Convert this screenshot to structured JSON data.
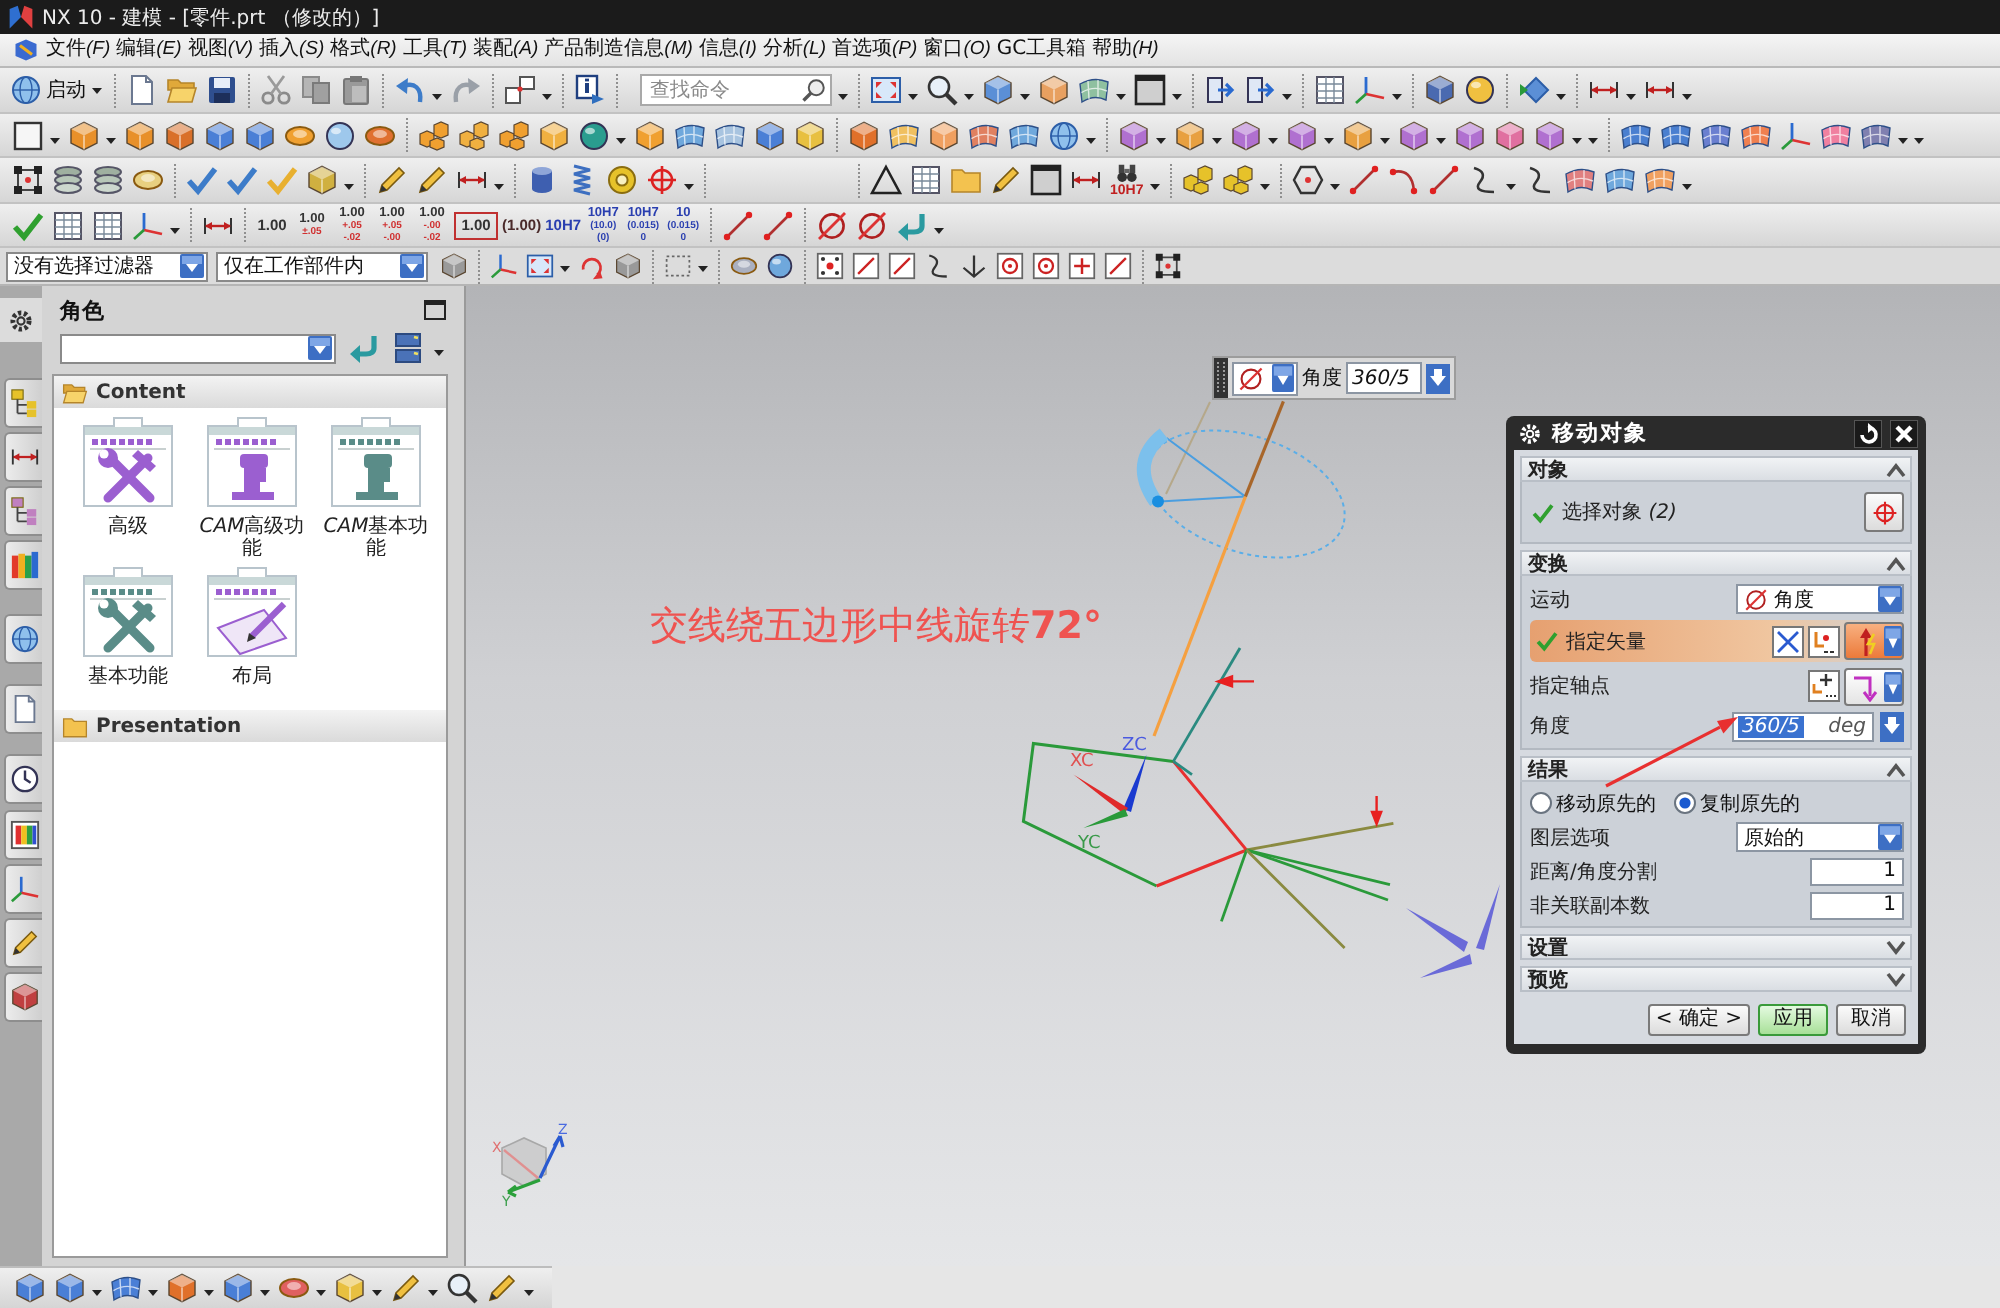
{
  "window": {
    "title": "NX 10 - 建模 - [零件.prt （修改的）]"
  },
  "menu": [
    {
      "label": "文件",
      "key": "(F)"
    },
    {
      "label": "编辑",
      "key": "(E)"
    },
    {
      "label": "视图",
      "key": "(V)"
    },
    {
      "label": "插入",
      "key": "(S)"
    },
    {
      "label": "格式",
      "key": "(R)"
    },
    {
      "label": "工具",
      "key": "(T)"
    },
    {
      "label": "装配",
      "key": "(A)"
    },
    {
      "label": "产品制造信息",
      "key": "(M)"
    },
    {
      "label": "信息",
      "key": "(I)"
    },
    {
      "label": "分析",
      "key": "(L)"
    },
    {
      "label": "首选项",
      "key": "(P)"
    },
    {
      "label": "窗口",
      "key": "(O)"
    },
    {
      "label": "GC工具箱"
    },
    {
      "label": "帮助",
      "key": "(H)"
    }
  ],
  "toolbar": {
    "start_label": "启动",
    "search_placeholder": "查找命令",
    "fit_check_label": "10H7",
    "dimension_styles": [
      {
        "kind": "plain",
        "lines": [
          "1.00"
        ]
      },
      {
        "kind": "tolerance",
        "lines": [
          "1.00",
          "±.05"
        ]
      },
      {
        "kind": "tolerance",
        "lines": [
          "1.00",
          "+.05",
          "-.02"
        ]
      },
      {
        "kind": "tolerance",
        "lines": [
          "1.00",
          "+.05",
          "-.00"
        ]
      },
      {
        "kind": "tolerance",
        "lines": [
          "1.00",
          "-.00",
          "-.02"
        ]
      },
      {
        "kind": "basic",
        "lines": [
          "1.00"
        ]
      },
      {
        "kind": "reference",
        "lines": [
          "(1.00)"
        ]
      },
      {
        "kind": "fit",
        "lines": [
          "10H7"
        ]
      },
      {
        "kind": "fit",
        "lines": [
          "10H7",
          "(10.0)",
          "(0)"
        ]
      },
      {
        "kind": "fit",
        "lines": [
          "10H7",
          "(0.015)",
          "0"
        ]
      },
      {
        "kind": "fit",
        "lines": [
          "10",
          "(0.015)",
          "0"
        ]
      }
    ]
  },
  "selection_bar": {
    "type_filter": "没有选择过滤器",
    "scope_filter": "仅在工作部件内"
  },
  "role_panel": {
    "title": "角色",
    "sections": [
      {
        "title": "Content",
        "expanded": true,
        "items": [
          {
            "label": "高级",
            "kind": "tools",
            "color": "#9b5fd0"
          },
          {
            "tag": "CAM",
            "label": "高级功能",
            "kind": "machine",
            "color": "#9b5fd0"
          },
          {
            "tag": "CAM",
            "label": "基本功能",
            "kind": "machine",
            "color": "#5a8c88"
          },
          {
            "label": "基本功能",
            "kind": "tools",
            "color": "#5a8c88"
          },
          {
            "label": "布局",
            "kind": "layout",
            "color": "#9b5fd0"
          }
        ]
      },
      {
        "title": "Presentation",
        "expanded": false
      }
    ]
  },
  "canvas": {
    "note": "交线绕五边形中线旋转**72°**",
    "wcs_labels": [
      "XC",
      "YC",
      "ZC"
    ],
    "view_triad_labels": [
      "X",
      "Y",
      "Z"
    ]
  },
  "angle_toolbar": {
    "label": "角度",
    "value": "360/5"
  },
  "dialog": {
    "title": "移动对象",
    "object_group": {
      "title": "对象",
      "expanded": true,
      "select_row": {
        "label": "选择对象 *(2)*",
        "done": true
      }
    },
    "transform_group": {
      "title": "变换",
      "expanded": true,
      "motion": {
        "label": "运动",
        "value": "角度"
      },
      "vector": {
        "label": "指定矢量",
        "done": true,
        "active": true
      },
      "pivot": {
        "label": "指定轴点"
      },
      "angle": {
        "label": "角度",
        "value": "360/5",
        "unit": "deg",
        "text_selected": true
      }
    },
    "result_group": {
      "title": "结果",
      "expanded": true,
      "modes": [
        {
          "label": "移动原先的",
          "selected": false
        },
        {
          "label": "复制原先的",
          "selected": true
        }
      ],
      "layer": {
        "label": "图层选项",
        "value": "原始的"
      },
      "divisions": {
        "label": "距离/角度分割",
        "value": "1"
      },
      "copies": {
        "label": "非关联副本数",
        "value": "1"
      }
    },
    "more_groups": [
      {
        "title": "设置",
        "expanded": false
      },
      {
        "title": "预览",
        "expanded": false
      }
    ],
    "buttons": [
      {
        "label": "< 确定 >",
        "kind": "ok"
      },
      {
        "label": "应用",
        "kind": "apply"
      },
      {
        "label": "取消",
        "kind": "cancel"
      }
    ]
  }
}
